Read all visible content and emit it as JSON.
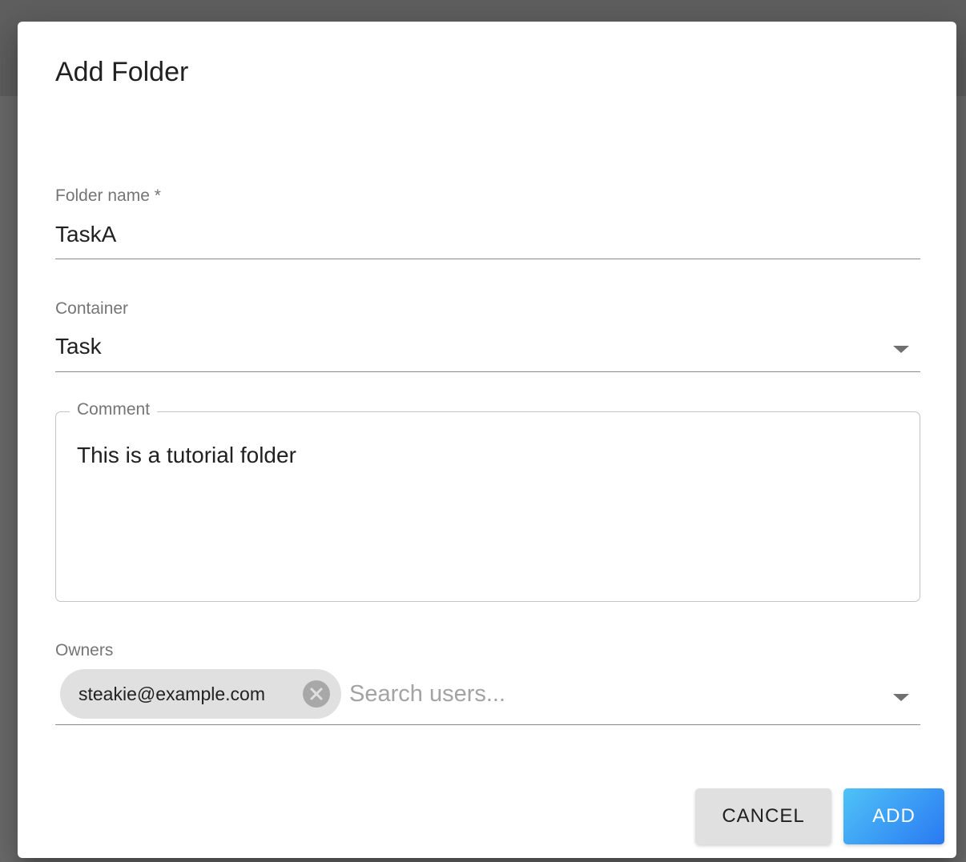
{
  "dialog": {
    "title": "Add Folder"
  },
  "folder_name": {
    "label": "Folder name *",
    "value": "TaskA"
  },
  "container": {
    "label": "Container",
    "value": "Task"
  },
  "comment": {
    "label": "Comment",
    "value": "This is a tutorial folder"
  },
  "owners": {
    "label": "Owners",
    "chips": [
      "steakie@example.com"
    ],
    "search_placeholder": "Search users..."
  },
  "actions": {
    "cancel_label": "CANCEL",
    "add_label": "ADD"
  },
  "colors": {
    "add_button_start": "#4fc3f7",
    "add_button_end": "#2979f2",
    "chip_background": "#e0e0e0"
  },
  "icons": {
    "container_dropdown": "caret-down-icon",
    "owners_dropdown": "caret-down-icon",
    "chip_remove": "cancel-circle-icon"
  }
}
